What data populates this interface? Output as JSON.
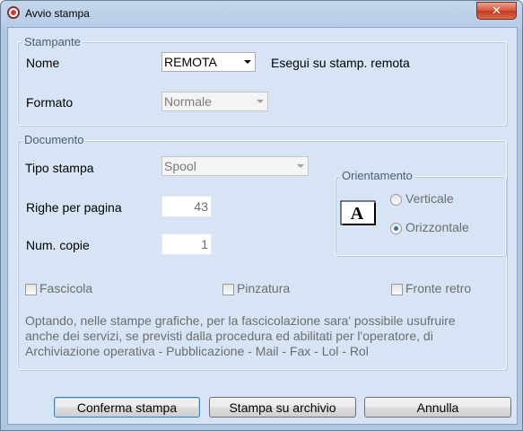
{
  "window": {
    "title": "Avvio stampa",
    "close_glyph": "✕"
  },
  "stampante": {
    "legend": "Stampante",
    "nome_label": "Nome",
    "nome_value": "REMOTA",
    "remote_note": "Esegui su stamp. remota",
    "formato_label": "Formato",
    "formato_value": "Normale"
  },
  "documento": {
    "legend": "Documento",
    "tipo_label": "Tipo stampa",
    "tipo_value": "Spool",
    "righe_label": "Righe per pagina",
    "righe_value": "43",
    "copie_label": "Num. copie",
    "copie_value": "1",
    "orientamento": {
      "legend": "Orientamento",
      "icon": "page-landscape-A-icon",
      "icon_letter": "A",
      "verticale": "Verticale",
      "orizzontale": "Orizzontale",
      "selected": "Orizzontale"
    },
    "fascicola": "Fascicola",
    "pinzatura": "Pinzatura",
    "fronte_retro": "Fronte retro",
    "info_lines": [
      "Optando, nelle stampe grafiche, per la fascicolazione sara' possibile usufruire",
      "anche dei servizi,  se previsti dalla procedura ed abilitati per l'operatore, di",
      "Archiviazione operativa - Pubblicazione - Mail - Fax - Lol - Rol"
    ]
  },
  "buttons": {
    "conferma": "Conferma stampa",
    "archivio": "Stampa su archivio",
    "annulla": "Annulla"
  }
}
